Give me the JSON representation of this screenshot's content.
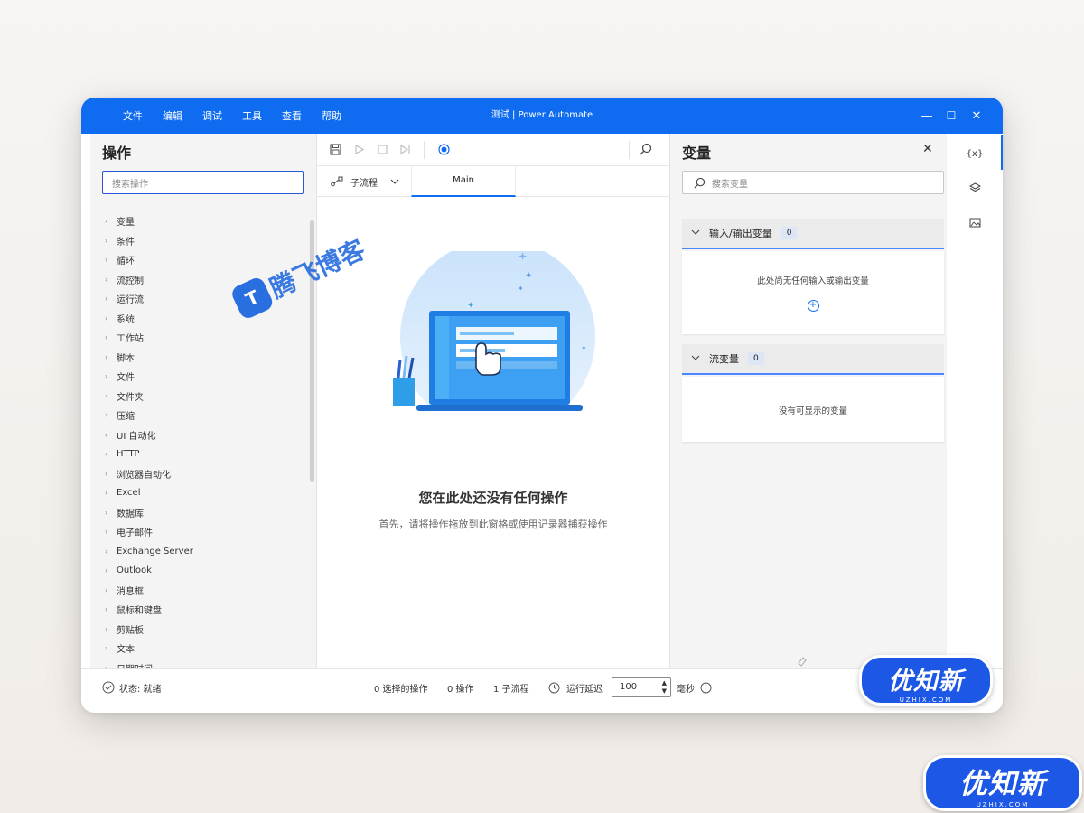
{
  "window": {
    "title": "测试 | Power Automate",
    "menu": [
      "文件",
      "编辑",
      "调试",
      "工具",
      "查看",
      "帮助"
    ],
    "controls": {
      "minimize": "—",
      "maximize": "☐",
      "close": "✕"
    }
  },
  "actions_panel": {
    "title": "操作",
    "search_placeholder": "搜索操作",
    "items": [
      "变量",
      "条件",
      "循环",
      "流控制",
      "运行流",
      "系统",
      "工作站",
      "脚本",
      "文件",
      "文件夹",
      "压缩",
      "UI 自动化",
      "HTTP",
      "浏览器自动化",
      "Excel",
      "数据库",
      "电子邮件",
      "Exchange Server",
      "Outlook",
      "消息框",
      "鼠标和键盘",
      "剪贴板",
      "文本",
      "日期时间"
    ]
  },
  "designer": {
    "subflow_label": "子流程",
    "main_tab": "Main",
    "empty_title": "您在此处还没有任何操作",
    "empty_subtitle": "首先，请将操作拖放到此窗格或使用记录器捕获操作"
  },
  "variables_panel": {
    "title": "变量",
    "search_placeholder": "搜索变量",
    "io_section": {
      "label": "输入/输出变量",
      "count": "0",
      "empty": "此处尚无任何输入或输出变量"
    },
    "flow_section": {
      "label": "流变量",
      "count": "0",
      "empty": "没有可显示的变量"
    }
  },
  "icon_strip": {
    "variables": "{x}"
  },
  "status_bar": {
    "status": "状态: 就绪",
    "selected": "0 选择的操作",
    "actions": "0 操作",
    "subflows": "1 子流程",
    "delay_label": "运行延迟",
    "delay_value": "100",
    "delay_unit": "毫秒"
  },
  "watermarks": {
    "tengfei": "腾飞博客",
    "uzhix_title": "优知新",
    "uzhix_sub": "UZHIX.COM"
  },
  "colors": {
    "accent": "#0f6cf0",
    "badge": "#1c57e6"
  }
}
